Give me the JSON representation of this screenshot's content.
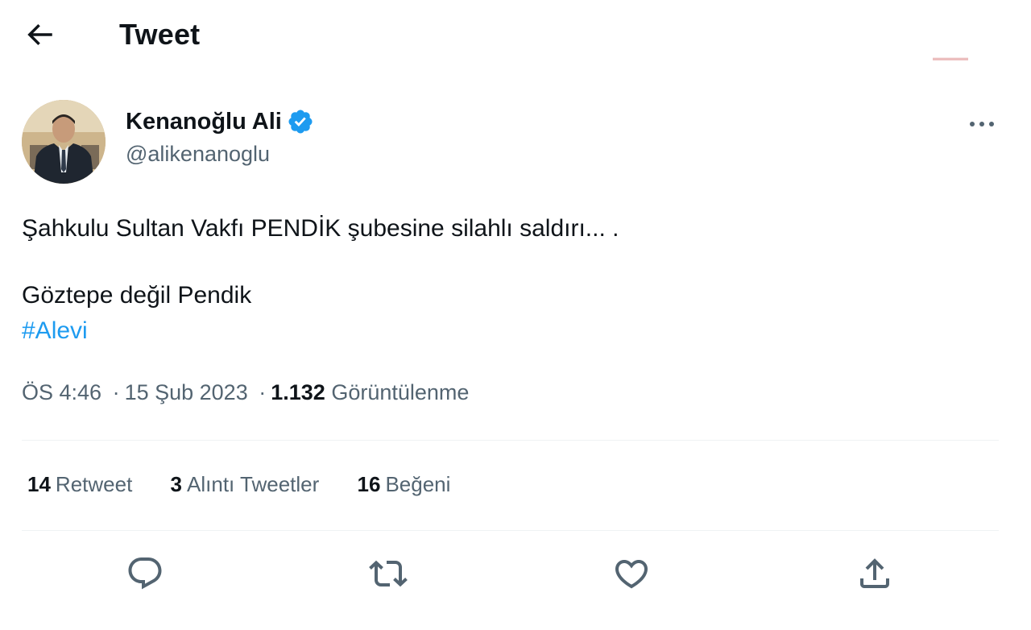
{
  "header": {
    "title": "Tweet",
    "back_icon": "arrow-left-icon"
  },
  "tweet": {
    "author": {
      "name": "Kenanoğlu Ali",
      "handle": "@alikenanoglu",
      "verified_icon": "verified-badge-icon",
      "verified_color": "#1d9bf0"
    },
    "text_line1": "Şahkulu Sultan Vakfı PENDİK şubesine silahlı saldırı... .",
    "text_line2": "Göztepe değil Pendik",
    "hashtag": "#Alevi",
    "time": "ÖS 4:46",
    "dot1": "·",
    "date": "15 Şub 2023",
    "dot2": "·",
    "views_count": "1.132",
    "views_label": "Görüntülenme"
  },
  "stats": [
    {
      "count": "14",
      "label": "Retweet"
    },
    {
      "count": "3",
      "label": "Alıntı Tweetler"
    },
    {
      "count": "16",
      "label": "Beğeni"
    }
  ],
  "actions": [
    "reply-icon",
    "retweet-icon",
    "like-icon",
    "share-icon"
  ],
  "colors": {
    "text": "#0f1419",
    "secondary": "#536471",
    "link": "#1d9bf0",
    "divider": "#eff3f4"
  }
}
